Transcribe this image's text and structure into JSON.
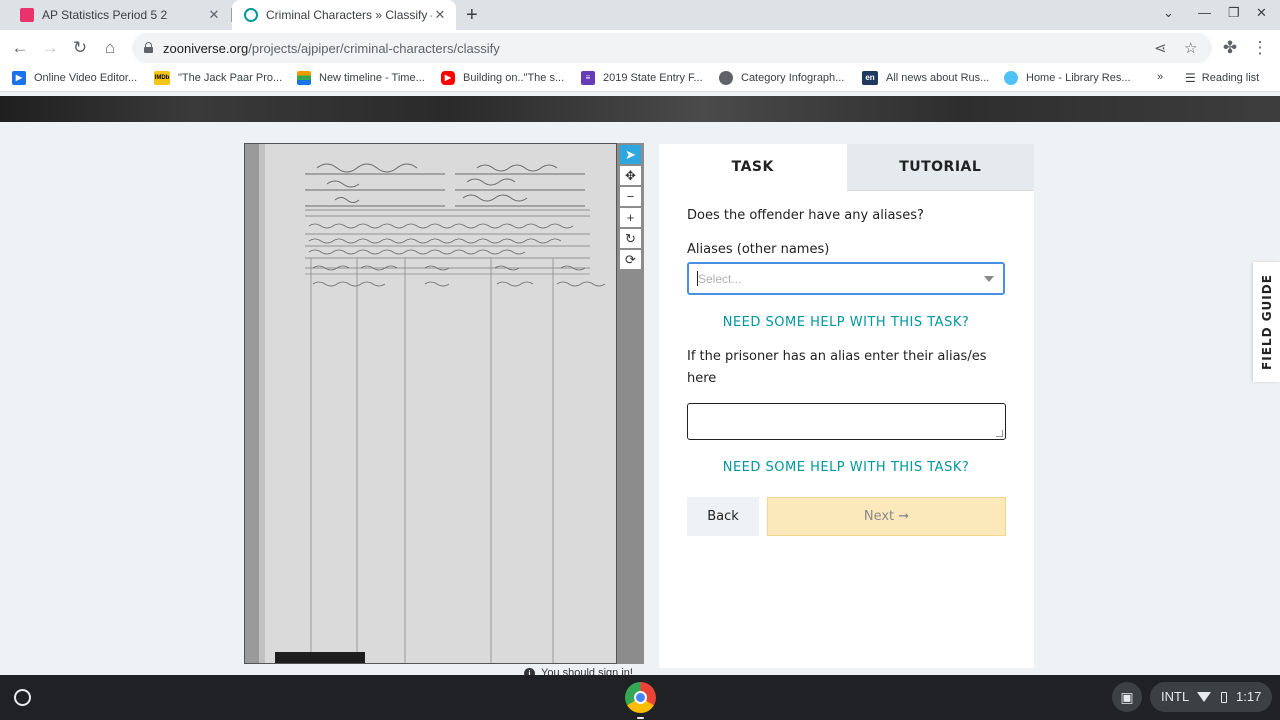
{
  "browser": {
    "tabs": [
      {
        "title": "AP Statistics Period 5 2",
        "active": false,
        "favicon_color": "#e8336d"
      },
      {
        "title": "Criminal Characters » Classify —",
        "active": true,
        "favicon_color": "#00979d"
      }
    ],
    "new_tab_label": "+",
    "url_host": "zooniverse.org",
    "url_path": "/projects/ajpiper/criminal-characters/classify",
    "bookmarks": [
      {
        "label": "Online Video Editor...",
        "icon": "video-editor-icon",
        "color": "#1a73e8"
      },
      {
        "label": "\"The Jack Paar Pro...",
        "icon": "imdb-icon",
        "color": "#f5c518"
      },
      {
        "label": "New timeline - Time...",
        "icon": "timeline-icon",
        "color": "#f29900"
      },
      {
        "label": "Building on..\"The s...",
        "icon": "youtube-icon",
        "color": "#ff0000"
      },
      {
        "label": "2019 State Entry F...",
        "icon": "forms-icon",
        "color": "#673ab7"
      },
      {
        "label": "Category Infograph...",
        "icon": "globe-icon",
        "color": "#5f6368"
      },
      {
        "label": "All news about Rus...",
        "icon": "en-icon",
        "color": "#1e3a5f"
      },
      {
        "label": "Home - Library Res...",
        "icon": "cloud-icon",
        "color": "#4fc3f7"
      }
    ],
    "bookmarks_overflow": "»",
    "reading_list": "Reading list",
    "imdb_badge": "IMDb",
    "en_badge": "en"
  },
  "subject": {
    "alt": "Scanned prison register page"
  },
  "tools": [
    {
      "name": "pointer-tool",
      "glyph": "➤",
      "active": true
    },
    {
      "name": "move-tool",
      "glyph": "✥",
      "active": false
    },
    {
      "name": "zoom-out-tool",
      "glyph": "−",
      "active": false
    },
    {
      "name": "zoom-in-tool",
      "glyph": "+",
      "active": false
    },
    {
      "name": "rotate-tool",
      "glyph": "↻",
      "active": false
    },
    {
      "name": "reset-tool",
      "glyph": "⟳",
      "active": false
    }
  ],
  "signin_note": "You should sign in!",
  "task_panel": {
    "tabs": {
      "task": "TASK",
      "tutorial": "TUTORIAL"
    },
    "question1": "Does the offender have any aliases?",
    "aliases_label": "Aliases (other names)",
    "select_placeholder": "Select...",
    "help_link": "NEED SOME HELP WITH THIS TASK?",
    "question2": "If the prisoner has an alias enter their alias/es here",
    "textarea_value": "",
    "back_label": "Back",
    "next_label": "Next ➞"
  },
  "field_guide": "FIELD GUIDE",
  "shelf": {
    "ime": "INTL",
    "time": "1:17"
  }
}
